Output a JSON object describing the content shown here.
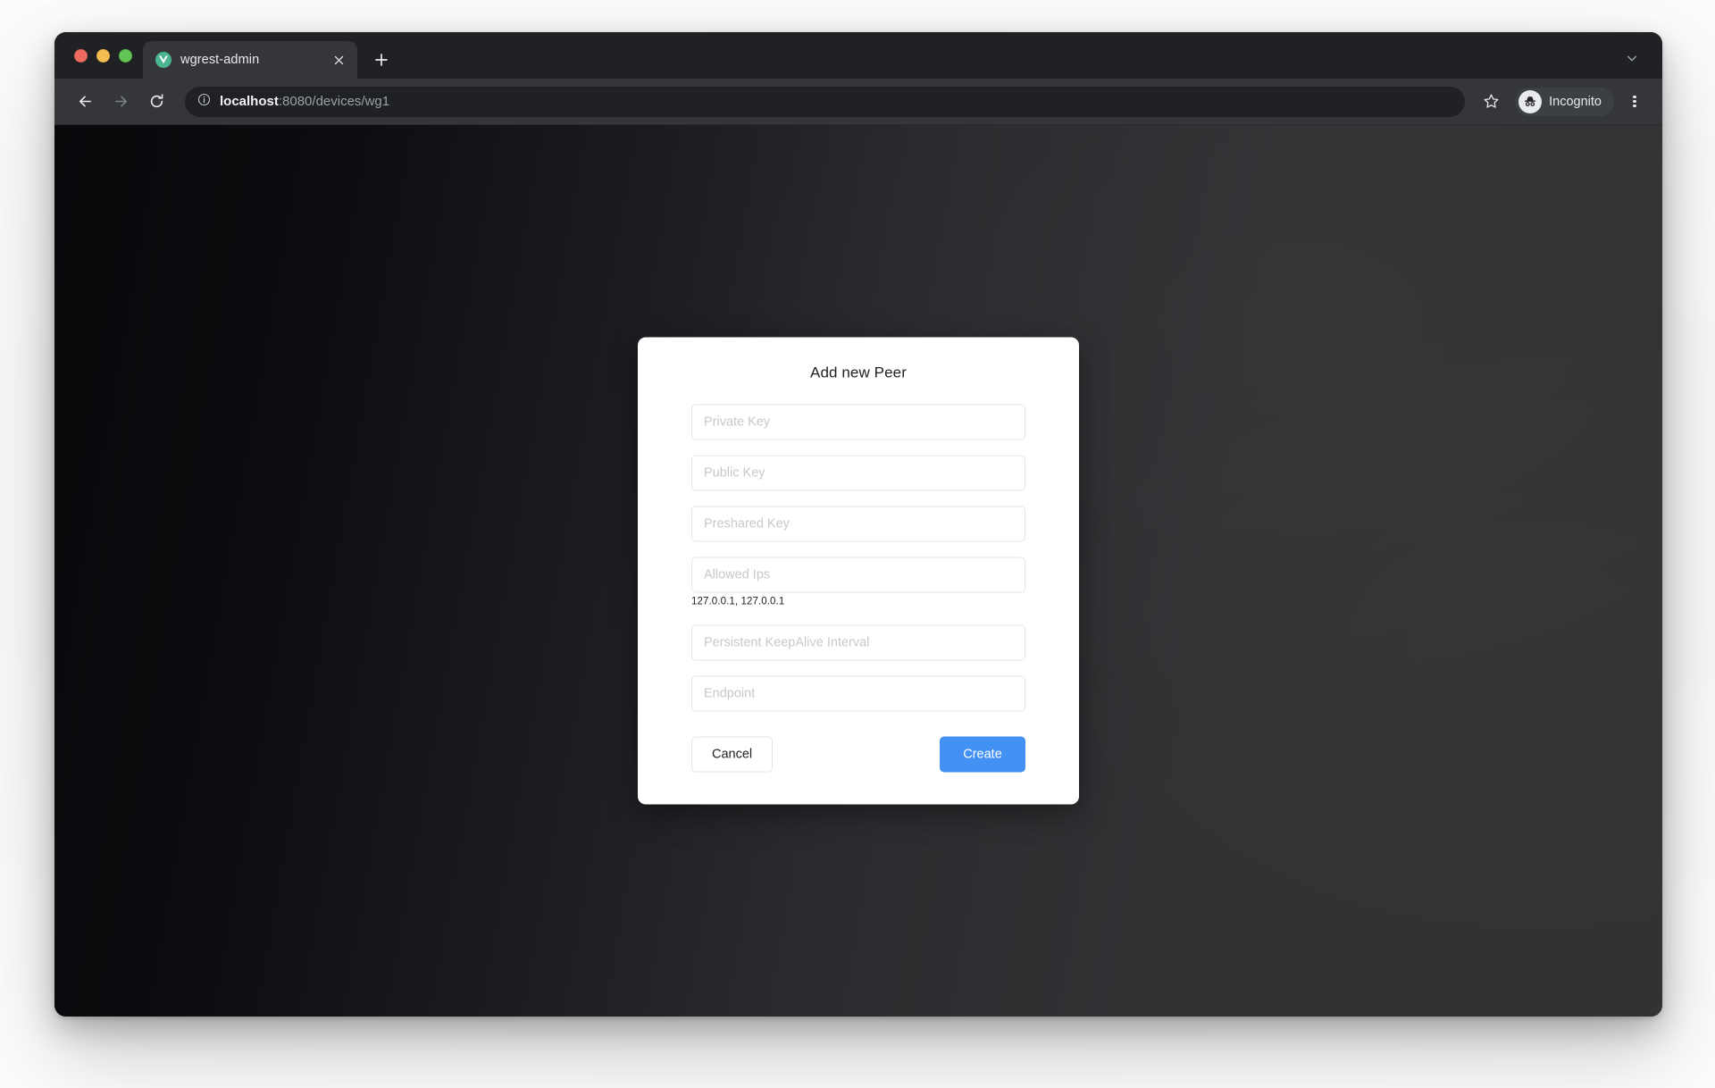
{
  "browser": {
    "window_controls": [
      {
        "name": "close",
        "color": "#ed6a5e"
      },
      {
        "name": "minimize",
        "color": "#f5bd4f"
      },
      {
        "name": "maximize",
        "color": "#61c454"
      }
    ],
    "tab": {
      "title": "wgrest-admin",
      "favicon": "vue-logo-icon",
      "close_icon": "close-icon"
    },
    "new_tab_icon": "plus-icon",
    "tab_search_icon": "chevron-down-icon",
    "nav": {
      "back_icon": "arrow-left-icon",
      "forward_icon": "arrow-right-icon",
      "reload_icon": "reload-icon"
    },
    "omnibox": {
      "info_icon": "info-circle-icon",
      "host": "localhost",
      "path": ":8080/devices/wg1",
      "full_url": "localhost:8080/devices/wg1",
      "placeholder": "Search Google or type a URL"
    },
    "bookmark_icon": "star-icon",
    "profile": {
      "label": "Incognito",
      "icon": "incognito-icon"
    },
    "menu_icon": "three-dot-menu-icon"
  },
  "page": {
    "background_gradient_from": "#08090b",
    "background_gradient_to": "#313234"
  },
  "modal": {
    "title": "Add new Peer",
    "fields": [
      {
        "name": "private-key",
        "placeholder": "Private Key",
        "value": "",
        "hint": null
      },
      {
        "name": "public-key",
        "placeholder": "Public Key",
        "value": "",
        "hint": null
      },
      {
        "name": "preshared-key",
        "placeholder": "Preshared Key",
        "value": "",
        "hint": null
      },
      {
        "name": "allowed-ips",
        "placeholder": "Allowed Ips",
        "value": "",
        "hint": "127.0.0.1, 127.0.0.1"
      },
      {
        "name": "persistent-keepalive-interval",
        "placeholder": "Persistent KeepAlive Interval",
        "value": "",
        "hint": null
      },
      {
        "name": "endpoint",
        "placeholder": "Endpoint",
        "value": "",
        "hint": null
      }
    ],
    "cancel_label": "Cancel",
    "create_label": "Create",
    "accent_color": "#4391f2"
  }
}
